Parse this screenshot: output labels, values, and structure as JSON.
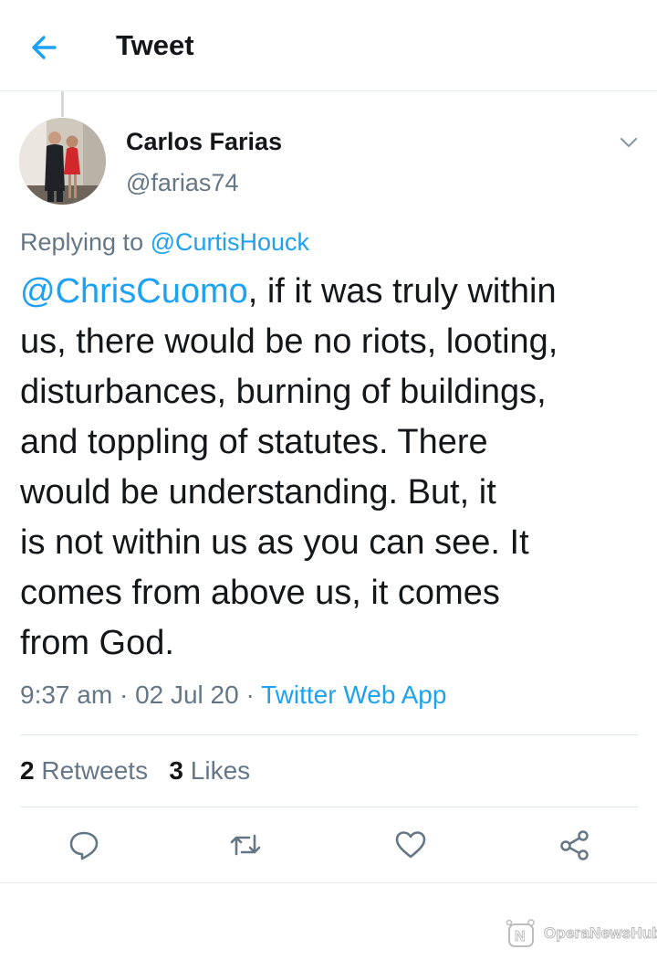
{
  "header": {
    "title": "Tweet",
    "back_icon": "arrow-left-icon"
  },
  "colors": {
    "accent": "#1da1f2",
    "secondary_text": "#657786",
    "primary_text": "#14171a",
    "divider": "#e1e8ed"
  },
  "author": {
    "name": "Carlos Farias",
    "handle": "@farias74"
  },
  "reply": {
    "prefix": "Replying to ",
    "target": "@CurtisHouck"
  },
  "tweet": {
    "mention": "@ChrisCuomo",
    "text": ", if it was truly within\nus, there would be no riots, looting,\ndisturbances, burning of buildings,\nand toppling of statutes. There\nwould be understanding. But, it\nis not within us as you can see. It\ncomes from above us, it comes\nfrom God."
  },
  "meta": {
    "time": "9:37 am",
    "sep1": " · ",
    "date": "02 Jul 20",
    "sep2": " · ",
    "source": "Twitter Web App"
  },
  "stats": {
    "retweets_count": "2",
    "retweets_label": "Retweets",
    "likes_count": "3",
    "likes_label": "Likes"
  },
  "actions": [
    "reply-icon",
    "retweet-icon",
    "like-icon",
    "share-icon"
  ],
  "watermark": {
    "text": "OperaNewsHub"
  }
}
